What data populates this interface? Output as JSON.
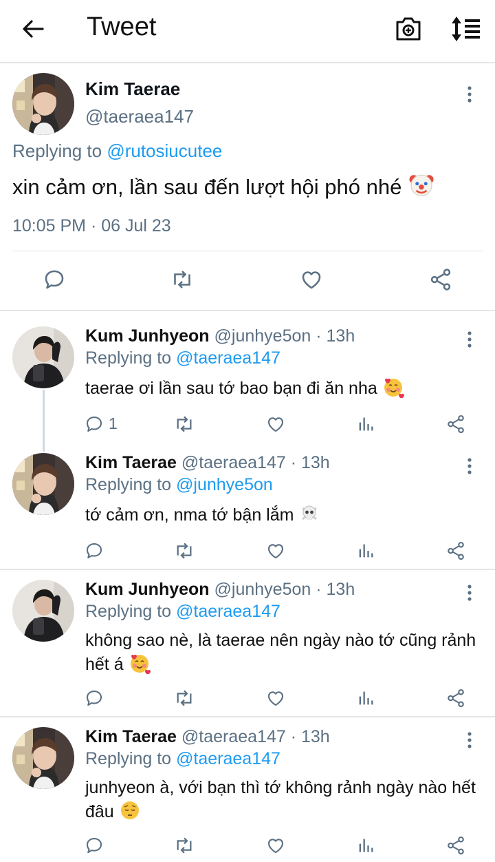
{
  "header": {
    "title": "Tweet",
    "icons": [
      "back-arrow-icon",
      "camera-icon",
      "sort-icon"
    ]
  },
  "main_tweet": {
    "name": "Kim Taerae",
    "handle": "@taeraea147",
    "replying_prefix": "Replying to ",
    "replying_to": "@rutosiucutee",
    "text": "xin cảm ơn, lần sau đến lượt hội phó nhé",
    "emoji": "clown-face",
    "timestamp": "10:05 PM · 06 Jul 23",
    "actions": [
      "reply-icon",
      "retweet-icon",
      "like-icon",
      "share-icon"
    ]
  },
  "replies": [
    {
      "name": "Kum Junhyeon",
      "handle": "@junhye5on · 13h",
      "replying_prefix": "Replying to ",
      "replying_to": "@taeraea147",
      "text": "taerae ơi lần sau tớ bao bạn đi ăn nha",
      "emoji": "smiling-face-with-hearts",
      "reply_count": "1"
    },
    {
      "name": "Kim Taerae",
      "handle": "@taeraea147 · 13h",
      "replying_prefix": "Replying to ",
      "replying_to": "@junhye5on",
      "text": "tớ cảm ơn, nma tớ bận lắm",
      "emoji": "skull-and-crossbones",
      "reply_count": ""
    },
    {
      "name": "Kum Junhyeon",
      "handle": "@junhye5on · 13h",
      "replying_prefix": "Replying to ",
      "replying_to": "@taeraea147",
      "text": "không sao nè, là taerae nên ngày nào tớ cũng rảnh hết á",
      "emoji": "smiling-face-with-hearts",
      "reply_count": ""
    },
    {
      "name": "Kim Taerae",
      "handle": "@taeraea147 · 13h",
      "replying_prefix": "Replying to ",
      "replying_to": "@taeraea147",
      "text": "junhyeon à, với bạn thì tớ không rảnh ngày nào hết đâu",
      "emoji": "pensive-face",
      "reply_count": ""
    }
  ],
  "colors": {
    "link": "#1d9bf0",
    "muted": "#5b7083",
    "divider": "#e3e6e8"
  }
}
